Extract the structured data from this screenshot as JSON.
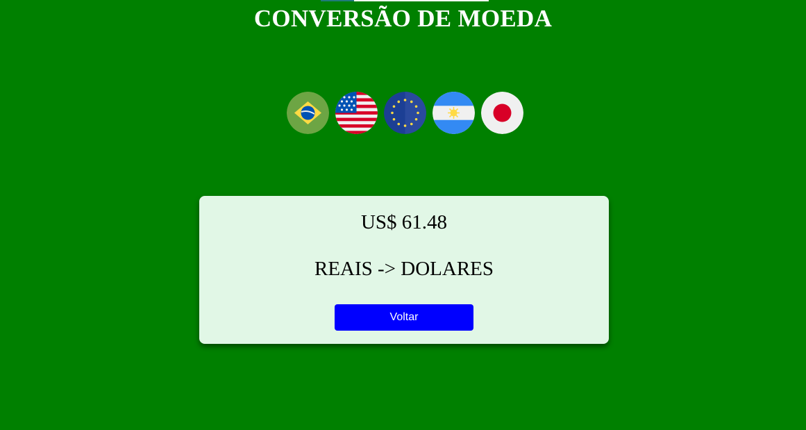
{
  "header": {
    "title": "CONVERSÃO DE MOEDA"
  },
  "flags": [
    {
      "name": "brazil",
      "icon": "brazil-flag-icon"
    },
    {
      "name": "usa",
      "icon": "usa-flag-icon"
    },
    {
      "name": "european-union",
      "icon": "eu-flag-icon"
    },
    {
      "name": "argentina",
      "icon": "argentina-flag-icon"
    },
    {
      "name": "japan",
      "icon": "japan-flag-icon"
    }
  ],
  "result": {
    "value": "US$ 61.48",
    "conversion": "REAIS -> DOLARES",
    "back_label": "Voltar"
  },
  "colors": {
    "background": "#008000",
    "card": "#e1f7e6",
    "button": "#0000ff",
    "title": "#ffffff"
  }
}
